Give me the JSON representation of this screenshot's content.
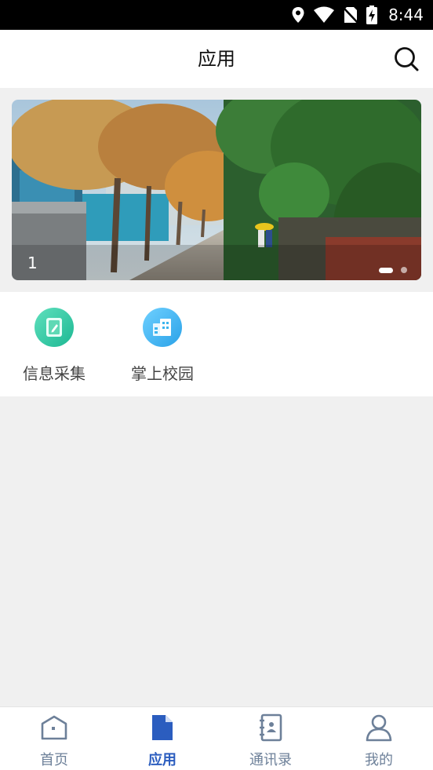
{
  "status_bar": {
    "time": "8:44"
  },
  "header": {
    "title": "应用"
  },
  "banner": {
    "index_label": "1"
  },
  "apps": [
    {
      "label": "信息采集",
      "icon": "note-pencil-icon",
      "color": "#2fc7a6"
    },
    {
      "label": "掌上校园",
      "icon": "building-icon",
      "color": "#3cb4ee"
    }
  ],
  "tabs": [
    {
      "label": "首页",
      "icon": "home-icon"
    },
    {
      "label": "应用",
      "icon": "document-icon",
      "active": true
    },
    {
      "label": "通讯录",
      "icon": "contacts-book-icon"
    },
    {
      "label": "我的",
      "icon": "person-icon"
    }
  ],
  "colors": {
    "accent": "#2b5dbf",
    "tab_inactive": "#6d8099"
  }
}
